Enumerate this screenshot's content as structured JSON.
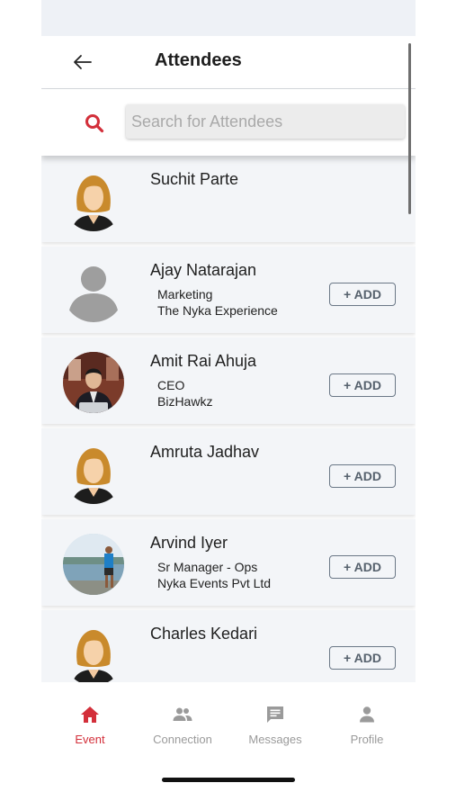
{
  "header": {
    "title": "Attendees",
    "back_icon": "arrow-left-icon"
  },
  "search": {
    "placeholder": "Search for Attendees",
    "value": "",
    "icon": "search-icon",
    "icon_color": "#d32f3a"
  },
  "attendees": [
    {
      "name": "Suchit Parte",
      "line1": "",
      "line2": "",
      "add_label": "",
      "avatar": "female-silhouette"
    },
    {
      "name": "Ajay Natarajan",
      "line1": "Marketing",
      "line2": "The Nyka Experience",
      "add_label": "+ ADD",
      "avatar": "generic-user"
    },
    {
      "name": "Amit Rai Ahuja",
      "line1": "CEO",
      "line2": "BizHawkz",
      "add_label": "+ ADD",
      "avatar": "photo"
    },
    {
      "name": "Amruta Jadhav",
      "line1": "",
      "line2": "",
      "add_label": "+ ADD",
      "avatar": "female-silhouette"
    },
    {
      "name": "Arvind Iyer",
      "line1": "Sr Manager - Ops",
      "line2": "Nyka Events Pvt Ltd",
      "add_label": "+ ADD",
      "avatar": "photo"
    },
    {
      "name": "Charles Kedari",
      "line1": "",
      "line2": "",
      "add_label": "+ ADD",
      "avatar": "female-silhouette"
    }
  ],
  "nav": {
    "items": [
      {
        "label": "Event",
        "icon": "home-icon",
        "active": true
      },
      {
        "label": "Connection",
        "icon": "people-icon",
        "active": false
      },
      {
        "label": "Messages",
        "icon": "message-icon",
        "active": false
      },
      {
        "label": "Profile",
        "icon": "person-icon",
        "active": false
      }
    ],
    "active_color": "#d32f3a",
    "inactive_color": "#9a9a9a"
  }
}
